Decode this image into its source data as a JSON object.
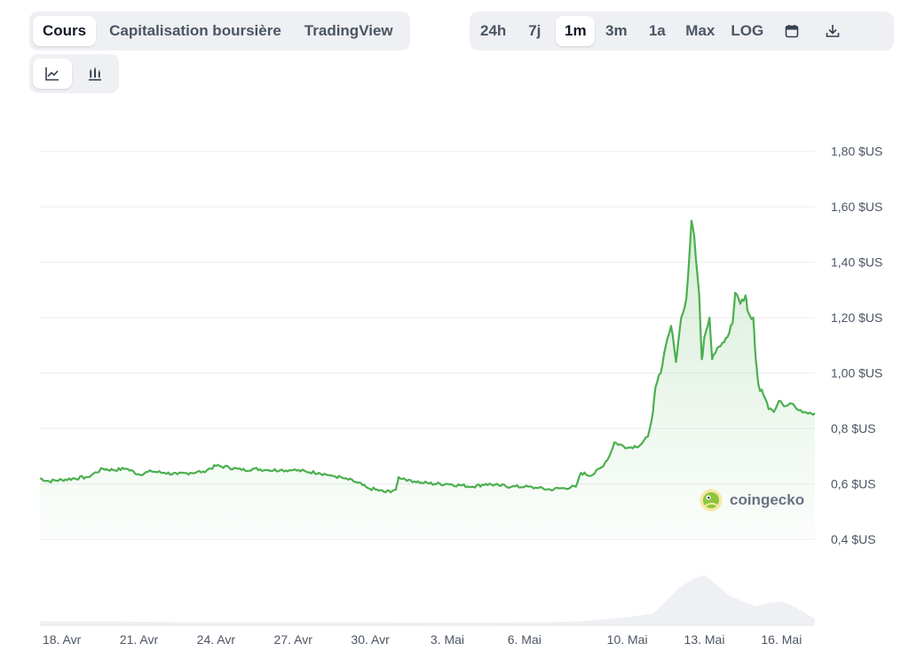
{
  "tabs": [
    {
      "label": "Cours",
      "active": true
    },
    {
      "label": "Capitalisation boursière",
      "active": false
    },
    {
      "label": "TradingView",
      "active": false
    }
  ],
  "ranges": [
    {
      "label": "24h",
      "active": false
    },
    {
      "label": "7j",
      "active": false
    },
    {
      "label": "1m",
      "active": true
    },
    {
      "label": "3m",
      "active": false
    },
    {
      "label": "1a",
      "active": false
    },
    {
      "label": "Max",
      "active": false
    },
    {
      "label": "LOG",
      "active": false
    }
  ],
  "toolbar_icons": [
    "calendar-icon",
    "download-icon"
  ],
  "chart_types": [
    {
      "icon": "line-chart-icon",
      "active": true
    },
    {
      "icon": "candlestick-chart-icon",
      "active": false
    }
  ],
  "watermark": {
    "text": "coingecko",
    "icon": "gecko-logo-icon"
  },
  "colors": {
    "line": "#4caf50",
    "fill": "#e7f5e8",
    "volume": "#eef0f3",
    "grid": "#eceef1"
  },
  "chart_data": {
    "type": "area",
    "y_ticks": [
      {
        "value": 1.8,
        "label": "1,80 $US"
      },
      {
        "value": 1.6,
        "label": "1,60 $US"
      },
      {
        "value": 1.4,
        "label": "1,40 $US"
      },
      {
        "value": 1.2,
        "label": "1,20 $US"
      },
      {
        "value": 1.0,
        "label": "1,00 $US"
      },
      {
        "value": 0.8,
        "label": "0,8 $US"
      },
      {
        "value": 0.6,
        "label": "0,6 $US"
      },
      {
        "value": 0.4,
        "label": "0,4 $US"
      }
    ],
    "x_ticks": [
      {
        "day": 1,
        "label": "18. Avr"
      },
      {
        "day": 4,
        "label": "21. Avr"
      },
      {
        "day": 7,
        "label": "24. Avr"
      },
      {
        "day": 10,
        "label": "27. Avr"
      },
      {
        "day": 13,
        "label": "30. Avr"
      },
      {
        "day": 16,
        "label": "3. Mai"
      },
      {
        "day": 19,
        "label": "6. Mai"
      },
      {
        "day": 23,
        "label": "10. Mai"
      },
      {
        "day": 26,
        "label": "13. Mai"
      },
      {
        "day": 29,
        "label": "16. Mai"
      }
    ],
    "x_range": [
      0.15,
      30.3
    ],
    "y_range": [
      0.33,
      1.85
    ],
    "grid": true,
    "series": [
      {
        "values": [
          [
            0.15,
            0.62
          ],
          [
            0.5,
            0.61
          ],
          [
            1.0,
            0.615
          ],
          [
            1.5,
            0.62
          ],
          [
            2.0,
            0.625
          ],
          [
            2.6,
            0.655
          ],
          [
            3.0,
            0.65
          ],
          [
            3.5,
            0.655
          ],
          [
            4.0,
            0.635
          ],
          [
            4.5,
            0.645
          ],
          [
            5.0,
            0.64
          ],
          [
            5.5,
            0.635
          ],
          [
            6.0,
            0.64
          ],
          [
            6.5,
            0.645
          ],
          [
            7.0,
            0.665
          ],
          [
            7.5,
            0.66
          ],
          [
            8.0,
            0.65
          ],
          [
            8.5,
            0.655
          ],
          [
            9.0,
            0.65
          ],
          [
            9.5,
            0.65
          ],
          [
            10.0,
            0.65
          ],
          [
            10.5,
            0.645
          ],
          [
            11.0,
            0.64
          ],
          [
            11.5,
            0.63
          ],
          [
            12.0,
            0.62
          ],
          [
            12.5,
            0.605
          ],
          [
            12.9,
            0.585
          ],
          [
            13.2,
            0.58
          ],
          [
            13.6,
            0.57
          ],
          [
            14.0,
            0.58
          ],
          [
            14.1,
            0.625
          ],
          [
            14.5,
            0.615
          ],
          [
            15.0,
            0.605
          ],
          [
            15.5,
            0.6
          ],
          [
            16.0,
            0.6
          ],
          [
            16.5,
            0.595
          ],
          [
            17.0,
            0.59
          ],
          [
            17.5,
            0.6
          ],
          [
            18.0,
            0.595
          ],
          [
            18.5,
            0.59
          ],
          [
            19.0,
            0.59
          ],
          [
            19.5,
            0.585
          ],
          [
            20.0,
            0.58
          ],
          [
            20.5,
            0.585
          ],
          [
            21.0,
            0.59
          ],
          [
            21.2,
            0.64
          ],
          [
            21.6,
            0.63
          ],
          [
            22.0,
            0.66
          ],
          [
            22.3,
            0.7
          ],
          [
            22.5,
            0.75
          ],
          [
            23.0,
            0.73
          ],
          [
            23.5,
            0.74
          ],
          [
            23.8,
            0.77
          ],
          [
            24.0,
            0.86
          ],
          [
            24.1,
            0.95
          ],
          [
            24.3,
            1.0
          ],
          [
            24.5,
            1.1
          ],
          [
            24.7,
            1.17
          ],
          [
            24.9,
            1.04
          ],
          [
            25.1,
            1.2
          ],
          [
            25.3,
            1.27
          ],
          [
            25.5,
            1.55
          ],
          [
            25.6,
            1.5
          ],
          [
            25.8,
            1.28
          ],
          [
            25.9,
            1.05
          ],
          [
            26.0,
            1.13
          ],
          [
            26.2,
            1.2
          ],
          [
            26.3,
            1.05
          ],
          [
            26.5,
            1.09
          ],
          [
            26.7,
            1.11
          ],
          [
            26.9,
            1.13
          ],
          [
            27.1,
            1.18
          ],
          [
            27.2,
            1.29
          ],
          [
            27.4,
            1.25
          ],
          [
            27.6,
            1.28
          ],
          [
            27.7,
            1.22
          ],
          [
            27.9,
            1.2
          ],
          [
            28.0,
            1.05
          ],
          [
            28.1,
            0.96
          ],
          [
            28.3,
            0.92
          ],
          [
            28.5,
            0.87
          ],
          [
            28.7,
            0.86
          ],
          [
            28.9,
            0.9
          ],
          [
            29.1,
            0.88
          ],
          [
            29.4,
            0.89
          ],
          [
            29.6,
            0.87
          ],
          [
            29.9,
            0.86
          ],
          [
            30.3,
            0.855
          ]
        ]
      }
    ],
    "volume": [
      [
        0.15,
        0.08
      ],
      [
        3,
        0.07
      ],
      [
        6,
        0.06
      ],
      [
        9,
        0.06
      ],
      [
        12,
        0.06
      ],
      [
        15,
        0.05
      ],
      [
        18,
        0.05
      ],
      [
        21,
        0.07
      ],
      [
        23,
        0.15
      ],
      [
        24,
        0.22
      ],
      [
        24.5,
        0.45
      ],
      [
        25,
        0.7
      ],
      [
        25.5,
        0.85
      ],
      [
        26,
        0.95
      ],
      [
        26.5,
        0.75
      ],
      [
        27,
        0.55
      ],
      [
        27.5,
        0.45
      ],
      [
        28,
        0.35
      ],
      [
        28.5,
        0.42
      ],
      [
        29,
        0.45
      ],
      [
        29.5,
        0.35
      ],
      [
        30.3,
        0.12
      ]
    ]
  }
}
